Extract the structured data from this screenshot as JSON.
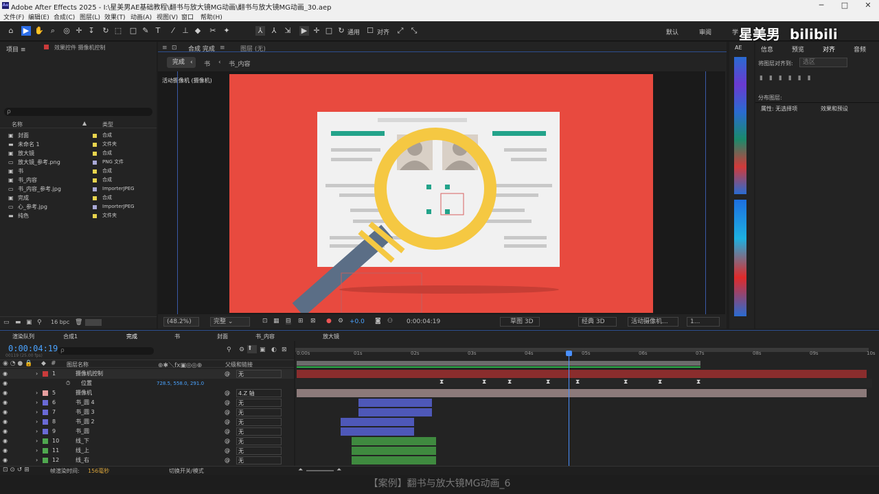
{
  "window": {
    "title": "Adobe After Effects 2025 - I:\\星美男AE基础教程\\翻书与放大镜MG动画\\翻书与放大镜MG动画_30.aep",
    "minimize": "─",
    "maximize": "□",
    "close": "✕"
  },
  "menu": [
    "文件(F)",
    "编辑(E)",
    "合成(C)",
    "图层(L)",
    "效果(T)",
    "动画(A)",
    "视图(V)",
    "窗口",
    "帮助(H)"
  ],
  "toolbar": {
    "snap_label": "通用",
    "align_label": "对齐",
    "workspaces": [
      "默认",
      "审阅",
      "学"
    ]
  },
  "watermark": {
    "name": "星美男",
    "brand": "bilibili"
  },
  "project_panel": {
    "tab": "项目",
    "effects_tab": "效果控件 摄像机控制",
    "search_placeholder": "ρ",
    "columns": {
      "name": "名称",
      "type": "类型"
    },
    "items": [
      {
        "name": "封面",
        "type": "合成",
        "color": "#e8d44d",
        "icon": "comp"
      },
      {
        "name": "未命名 1",
        "type": "文件夹",
        "color": "#e8d44d",
        "icon": "folder"
      },
      {
        "name": "放大镜",
        "type": "合成",
        "color": "#e8d44d",
        "icon": "comp"
      },
      {
        "name": "放大镜_参考.png",
        "type": "PNG 文件",
        "color": "#a9a9d6",
        "icon": "file"
      },
      {
        "name": "书",
        "type": "合成",
        "color": "#e8d44d",
        "icon": "comp"
      },
      {
        "name": "书_内容",
        "type": "合成",
        "color": "#e8d44d",
        "icon": "comp"
      },
      {
        "name": "书_内容_参考.jpg",
        "type": "ImporterJPEG",
        "color": "#a9a9d6",
        "icon": "file"
      },
      {
        "name": "完成",
        "type": "合成",
        "color": "#e8d44d",
        "icon": "comp"
      },
      {
        "name": "心_参考.jpg",
        "type": "ImporterJPEG",
        "color": "#a9a9d6",
        "icon": "file"
      },
      {
        "name": "纯色",
        "type": "文件夹",
        "color": "#e8d44d",
        "icon": "folder"
      }
    ],
    "bpc": "16 bpc"
  },
  "comp_panel": {
    "tab": "合成 完成",
    "layer_tab": "图层 (无)",
    "breadcrumbs": [
      "完成",
      "书",
      "书_内容"
    ],
    "camera_label": "活动摄像机 (摄像机)",
    "zoom": "(48.2%)",
    "quality": "完整",
    "exposure": "+0.0",
    "timecode": "0:00:04:19",
    "draft3d": "草图 3D",
    "renderer": "经典 3D",
    "view": "活动摄像机...",
    "views_count": "1..."
  },
  "right_panel": {
    "tabs": [
      "信息",
      "预览",
      "对齐",
      "音频"
    ],
    "align_to_label": "将图层对齐到:",
    "align_to_value": "选区",
    "distribute_label": "分布图层:",
    "props_tab": "属性: 无选择项",
    "effects_presets_tab": "效果和预设"
  },
  "timeline": {
    "tabs": [
      "渲染队列",
      "合成1",
      "完成",
      "书",
      "封面",
      "书_内容",
      "放大镜"
    ],
    "timecode": "0:00:04:19",
    "frame_info": "00119 (25.00 fps)",
    "columns": {
      "layer_name": "图层名称",
      "parent": "父级和链接"
    },
    "ruler": [
      "0:00s",
      "01s",
      "02s",
      "03s",
      "04s",
      "05s",
      "06s",
      "07s",
      "08s",
      "09s",
      "10s"
    ],
    "layers": [
      {
        "num": "1",
        "name": "摄像机控制",
        "color": "#c93b3b",
        "parent": "无"
      },
      {
        "num": "",
        "name": "位置",
        "color": "",
        "parent": "",
        "value": "728.5, 558.0, 291.0"
      },
      {
        "num": "5",
        "name": "摄像机",
        "color": "#e8a0a0",
        "parent": "4.Z 轴"
      },
      {
        "num": "6",
        "name": "书_圆 4",
        "color": "#6a6ad6",
        "parent": "无"
      },
      {
        "num": "7",
        "name": "书_圆 3",
        "color": "#6a6ad6",
        "parent": "无"
      },
      {
        "num": "8",
        "name": "书_圆 2",
        "color": "#6a6ad6",
        "parent": "无"
      },
      {
        "num": "9",
        "name": "书_圆",
        "color": "#6a6ad6",
        "parent": "无"
      },
      {
        "num": "10",
        "name": "线_下",
        "color": "#4fa84f",
        "parent": "无"
      },
      {
        "num": "11",
        "name": "线_上",
        "color": "#4fa84f",
        "parent": "无"
      },
      {
        "num": "12",
        "name": "线_右",
        "color": "#4fa84f",
        "parent": "无"
      }
    ],
    "render_time_label": "帧渲染时间:",
    "render_time": "156毫秒",
    "toggle_label": "切换开关/模式"
  },
  "bottom_caption": "【案例】翻书与放大镜MG动画_6"
}
